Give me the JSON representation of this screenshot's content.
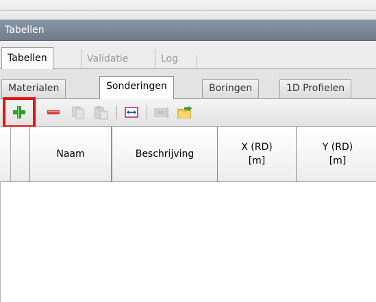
{
  "panel": {
    "title": "Tabellen"
  },
  "outer_tabs": [
    {
      "label": "Tabellen",
      "active": true
    },
    {
      "label": "Validatie",
      "active": false
    },
    {
      "label": "Log",
      "active": false
    }
  ],
  "inner_tabs": [
    {
      "label": "Materialen",
      "active": false
    },
    {
      "label": "Sonderingen",
      "active": true
    },
    {
      "label": "Boringen",
      "active": false
    },
    {
      "label": "1D Profielen",
      "active": false
    }
  ],
  "toolbar": {
    "icons": [
      "add-icon",
      "remove-icon",
      "copy-icon",
      "paste-icon",
      "range-icon",
      "property-icon",
      "import-folder-icon"
    ]
  },
  "table": {
    "columns": [
      {
        "label": ""
      },
      {
        "label": "Naam"
      },
      {
        "label": "Beschrijving"
      },
      {
        "label": "X (RD)\n[m]"
      },
      {
        "label": "Y (RD)\n[m]"
      }
    ]
  },
  "colors": {
    "highlight": "#e11313",
    "add": "#2e9b2e",
    "remove": "#d83a3a",
    "title_bar": "#7a8699"
  }
}
